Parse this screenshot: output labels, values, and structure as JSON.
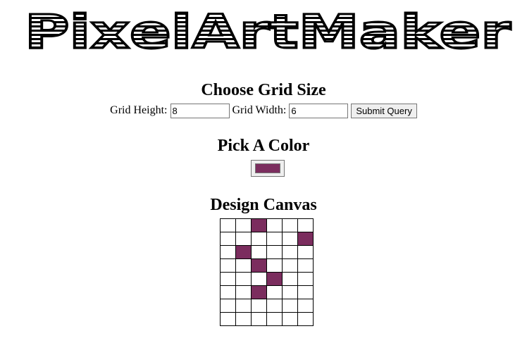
{
  "app": {
    "logo_text": "PixelArtMaker"
  },
  "grid_size": {
    "heading": "Choose Grid Size",
    "height_label": "Grid Height:",
    "height_value": "8",
    "width_label": "Grid Width:",
    "width_value": "6",
    "submit_label": "Submit Query"
  },
  "color": {
    "heading": "Pick A Color",
    "value": "#7b2d5e"
  },
  "canvas": {
    "heading": "Design Canvas",
    "rows": 8,
    "cols": 6,
    "fill_color": "#7b2d5e",
    "filled_cells": [
      [
        0,
        2
      ],
      [
        1,
        5
      ],
      [
        2,
        1
      ],
      [
        3,
        2
      ],
      [
        4,
        3
      ],
      [
        5,
        2
      ]
    ]
  }
}
